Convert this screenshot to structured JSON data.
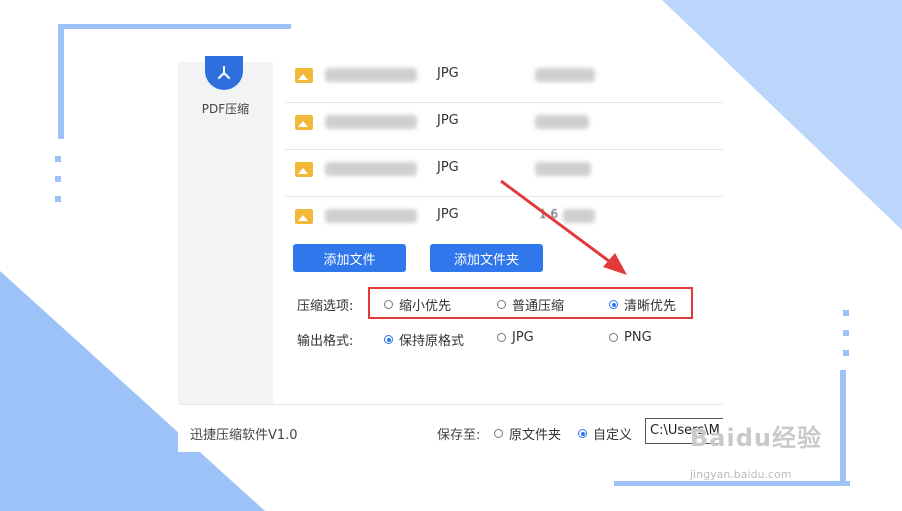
{
  "sidebar": {
    "item_label": "PDF压缩",
    "item_icon": "pdf-icon"
  },
  "files": {
    "rows": [
      {
        "format": "JPG",
        "size": ""
      },
      {
        "format": "JPG",
        "size": ""
      },
      {
        "format": "JPG",
        "size": ""
      },
      {
        "format": "JPG",
        "size": "1.6"
      }
    ]
  },
  "buttons": {
    "add_file": "添加文件",
    "add_folder": "添加文件夹"
  },
  "compress": {
    "label": "压缩选项:",
    "options": [
      {
        "label": "缩小优先",
        "selected": false
      },
      {
        "label": "普通压缩",
        "selected": false
      },
      {
        "label": "清晰优先",
        "selected": true
      }
    ]
  },
  "output": {
    "label": "输出格式:",
    "options": [
      {
        "label": "保持原格式",
        "selected": true
      },
      {
        "label": "JPG",
        "selected": false
      },
      {
        "label": "PNG",
        "selected": false
      }
    ]
  },
  "footer": {
    "version": "迅捷压缩软件V1.0",
    "save_to_label": "保存至:",
    "save_options": [
      {
        "label": "原文件夹",
        "selected": false
      },
      {
        "label": "自定义",
        "selected": true
      }
    ],
    "path_value": "C:\\Users\\M"
  },
  "watermark": {
    "brand": "Baidu经验",
    "url": "jingyan.baidu.com"
  },
  "colors": {
    "accent": "#2f77ea",
    "highlight": "#e23a3a",
    "frame": "#9cc2f7"
  }
}
